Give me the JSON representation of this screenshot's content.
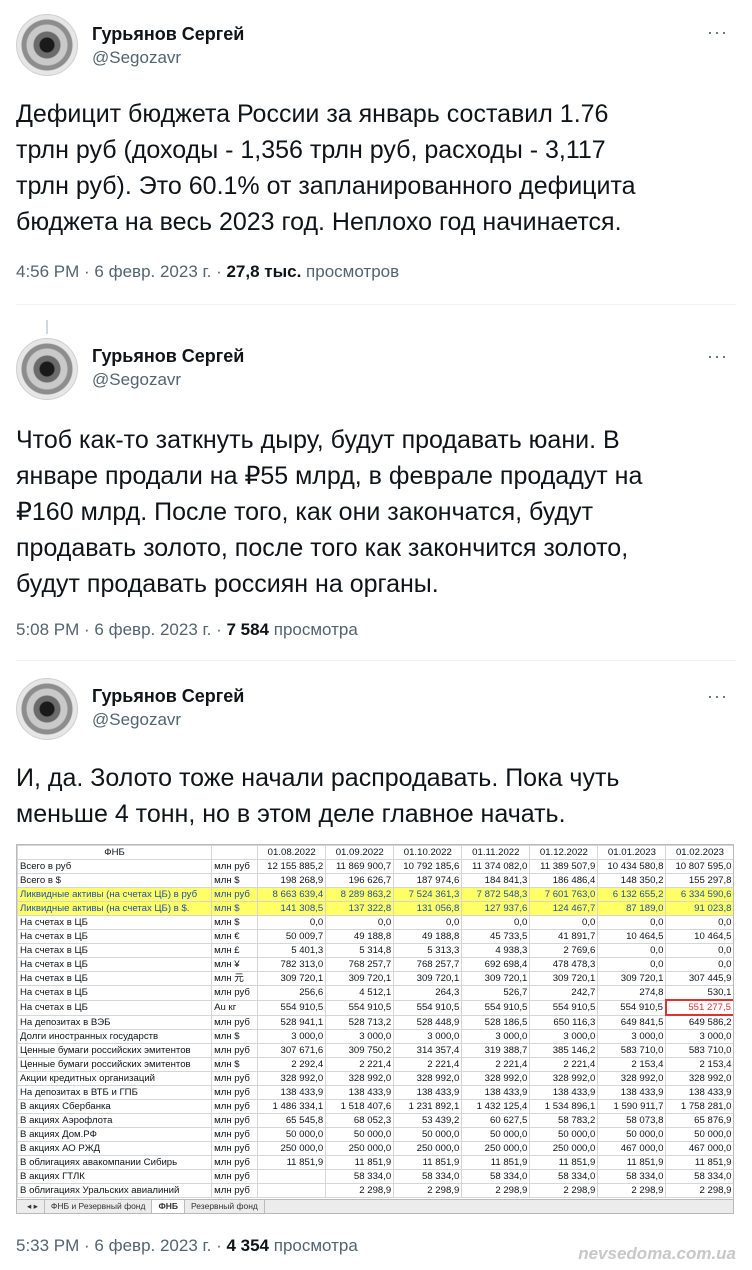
{
  "tweets": [
    {
      "name": "Гурьянов Сергей",
      "handle": "@Segozavr",
      "text_lines": [
        "Дефицит бюджета России за январь составил 1.76",
        "трлн руб (доходы - 1,356 трлн руб, расходы - 3,117",
        "трлн руб). Это 60.1% от запланированного дефицита",
        "бюджета на весь 2023 год. Неплохо год начинается."
      ],
      "time": "4:56 PM · 6 февр. 2023 г. · ",
      "views": "27,8 тыс.",
      "views_label": " просмотров"
    },
    {
      "name": "Гурьянов Сергей",
      "handle": "@Segozavr",
      "text_lines": [
        "Чтоб как-то заткнуть дыру, будут продавать юани. В",
        "январе продали на ₽55 млрд, в феврале продадут на",
        "₽160 млрд. После того, как они закончатся, будут",
        "продавать золото, после того как закончится золото,",
        "будут продавать россиян на органы."
      ],
      "time": "5:08 PM · 6 февр. 2023 г. · ",
      "views": "7 584",
      "views_label": " просмотра"
    },
    {
      "name": "Гурьянов Сергей",
      "handle": "@Segozavr",
      "text_lines": [
        "И, да. Золото тоже начали распродавать. Пока чуть",
        "меньше 4 тонн, но в этом деле главное начать."
      ],
      "time": "5:33 PM · 6 февр. 2023 г. · ",
      "views": "4 354",
      "views_label": " просмотра"
    }
  ],
  "more_icon": "···",
  "sheet": {
    "title": "ФНБ",
    "dates": [
      "01.08.2022",
      "01.09.2022",
      "01.10.2022",
      "01.11.2022",
      "01.12.2022",
      "01.01.2023",
      "01.02.2023"
    ],
    "rows": [
      [
        "Всего в руб",
        "млн руб",
        "12 155 885,2",
        "11 869 900,7",
        "10 792 185,6",
        "11 374 082,0",
        "11 389 507,9",
        "10 434 580,8",
        "10 807 595,0"
      ],
      [
        "Всего в $",
        "млн $",
        "198 268,9",
        "196 626,7",
        "187 974,6",
        "184 841,3",
        "186 486,4",
        "148 350,2",
        "155 297,8"
      ],
      [
        "Ликвидные активы (на счетах ЦБ) в руб",
        "млн руб",
        "8 663 639,4",
        "8 289 863,2",
        "7 524 361,3",
        "7 872 548,3",
        "7 601 763,0",
        "6 132 655,2",
        "6 334 590,6"
      ],
      [
        "Ликвидные активы (на счетах ЦБ) в $.",
        "млн $",
        "141 308,5",
        "137 322,8",
        "131 056,8",
        "127 937,6",
        "124 467,7",
        "87 189,0",
        "91 023,8"
      ],
      [
        "На счетах в ЦБ",
        "млн $",
        "0,0",
        "0,0",
        "0,0",
        "0,0",
        "0,0",
        "0,0",
        "0,0"
      ],
      [
        "На счетах в ЦБ",
        "млн €",
        "50 009,7",
        "49 188,8",
        "49 188,8",
        "45 733,5",
        "41 891,7",
        "10 464,5",
        "10 464,5"
      ],
      [
        "На счетах в ЦБ",
        "млн £",
        "5 401,3",
        "5 314,8",
        "5 313,3",
        "4 938,3",
        "2 769,6",
        "0,0",
        "0,0"
      ],
      [
        "На счетах в ЦБ",
        "млн ¥",
        "782 313,0",
        "768 257,7",
        "768 257,7",
        "692 698,4",
        "478 478,3",
        "0,0",
        "0,0"
      ],
      [
        "На счетах в ЦБ",
        "млн 元",
        "309 720,1",
        "309 720,1",
        "309 720,1",
        "309 720,1",
        "309 720,1",
        "309 720,1",
        "307 445,9"
      ],
      [
        "На счетах в ЦБ",
        "млн руб",
        "256,6",
        "4 512,1",
        "264,3",
        "526,7",
        "242,7",
        "274,8",
        "530,1"
      ],
      [
        "На счетах в ЦБ",
        "Au кг",
        "554 910,5",
        "554 910,5",
        "554 910,5",
        "554 910,5",
        "554 910,5",
        "554 910,5",
        "551 277,5"
      ],
      [
        "На депозитах в ВЭБ",
        "млн руб",
        "528 941,1",
        "528 713,2",
        "528 448,9",
        "528 186,5",
        "650 116,3",
        "649 841,5",
        "649 586,2"
      ],
      [
        "Долги иностранных государств",
        "млн $",
        "3 000,0",
        "3 000,0",
        "3 000,0",
        "3 000,0",
        "3 000,0",
        "3 000,0",
        "3 000,0"
      ],
      [
        "Ценные бумаги российских эмитентов",
        "млн руб",
        "307 671,6",
        "309 750,2",
        "314 357,4",
        "319 388,7",
        "385 146,2",
        "583 710,0",
        "583 710,0"
      ],
      [
        "Ценные бумаги российских эмитентов",
        "млн $",
        "2 292,4",
        "2 221,4",
        "2 221,4",
        "2 221,4",
        "2 221,4",
        "2 153,4",
        "2 153,4"
      ],
      [
        "Акции кредитных организаций",
        "млн руб",
        "328 992,0",
        "328 992,0",
        "328 992,0",
        "328 992,0",
        "328 992,0",
        "328 992,0",
        "328 992,0"
      ],
      [
        "На депозитах в ВТБ и ГПБ",
        "млн руб",
        "138 433,9",
        "138 433,9",
        "138 433,9",
        "138 433,9",
        "138 433,9",
        "138 433,9",
        "138 433,9"
      ],
      [
        "В акциях Сбербанка",
        "млн руб",
        "1 486 334,1",
        "1 518 407,6",
        "1 231 892,1",
        "1 432 125,4",
        "1 534 896,1",
        "1 590 911,7",
        "1 758 281,0"
      ],
      [
        "В акциях Аэрофлота",
        "млн руб",
        "65 545,8",
        "68 052,3",
        "53 439,2",
        "60 627,5",
        "58 783,2",
        "58 073,8",
        "65 876,9"
      ],
      [
        "В акциях Дом.РФ",
        "млн руб",
        "50 000,0",
        "50 000,0",
        "50 000,0",
        "50 000,0",
        "50 000,0",
        "50 000,0",
        "50 000,0"
      ],
      [
        "В акциях АО РЖД",
        "млн руб",
        "250 000,0",
        "250 000,0",
        "250 000,0",
        "250 000,0",
        "250 000,0",
        "467 000,0",
        "467 000,0"
      ],
      [
        "В облигациях авакомпании Сибирь",
        "млн руб",
        "11 851,9",
        "11 851,9",
        "11 851,9",
        "11 851,9",
        "11 851,9",
        "11 851,9",
        "11 851,9"
      ],
      [
        "В акциях ГТЛК",
        "млн руб",
        "",
        "58 334,0",
        "58 334,0",
        "58 334,0",
        "58 334,0",
        "58 334,0",
        "58 334,0"
      ],
      [
        "В облигациях Уральских авиалиний",
        "млн руб",
        "",
        "2 298,9",
        "2 298,9",
        "2 298,9",
        "2 298,9",
        "2 298,9",
        "2 298,9"
      ]
    ],
    "tabs": [
      "◂ ▸",
      "ФНБ и Резервный фонд",
      "ФНБ",
      "Резервный фонд"
    ]
  },
  "watermark": "nevsedoma.com.ua",
  "colors": {
    "highlight": "#ffff66",
    "highlight_text": "#1f4fb5",
    "red_box": "#e03030",
    "muted": "#536471"
  }
}
